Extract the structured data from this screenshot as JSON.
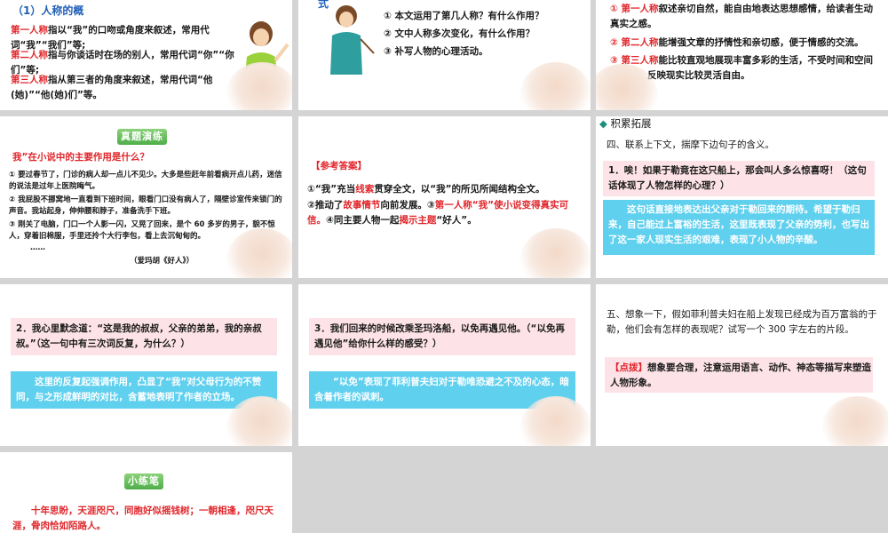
{
  "s1": {
    "heading": "（1）人称的概",
    "lines": [
      {
        "k": "第一人称",
        "v": "指以“我”的口吻或角度来叙述，常用代词“我”“我们”等;"
      },
      {
        "k": "第二人称",
        "v": "指与你谈话时在场的别人，常用代词“你”“你们”等;"
      },
      {
        "k": "第三人称",
        "v": "指从第三者的角度来叙述，常用代词“他(她)”“他(她)们”等。"
      }
    ]
  },
  "s2": {
    "corner": "式",
    "questions": [
      "① 本文运用了第几人称？有什么作用？",
      "② 文中人称多次变化，有什么作用？",
      "③ 补写人物的心理活动。"
    ]
  },
  "s3": {
    "lines": [
      {
        "k": "① 第一人称",
        "v": "叙述亲切自然，能自由地表达思想感情，给读者生动真实之感。"
      },
      {
        "k": "② 第二人称",
        "v": "能增强文章的抒情性和亲切感，便于情感的交流。"
      },
      {
        "k": "③ 第三人称",
        "v": "能比较直观地展现丰富多彩的生活，不受时间和空间的限制，反映现实比较灵活自由。"
      }
    ]
  },
  "s4": {
    "badge": "真题演练",
    "question": "我”在小说中的主要作用是什么？",
    "paras": [
      "① 要过春节了，门诊的病人却一点儿不见少。大多是些赶年前看病开点儿药，迷信的说法是过年上医院晦气。",
      "② 我屁股不挪窝地一直看到下班时间，眼看门口没有病人了，隔壁诊室传来锁门的声音。我站起身，伸伸腰和脖子，准备洗手下班。",
      "③ 刚关了电脑，门口一个人影一闪，又晃了回来，是个 60 多岁的男子，貌不惊人，穿着旧棉服，手里还拎个大行李包，看上去沉甸甸的。",
      "……"
    ],
    "source": "（爱玛胡《好人》）"
  },
  "s5": {
    "label": "【参考答案】",
    "a1_pre": "①“我”充当",
    "a1_hl": "线索",
    "a1_post": "贯穿全文，以“我”的所见所闻结构全文。",
    "a2_pre": "②推动了",
    "a2_hl": "故事情节",
    "a2_post": "向前发展。③",
    "a3_hl": "第一人称“我”使小说变得真实可信。",
    "a4_pre": "④同主要人物一起",
    "a4_hl": "揭示主题",
    "a4_post": "“好人”。"
  },
  "s6": {
    "tag": "积累拓展",
    "task": "四、联系上下文，揣摩下边句子的含义。",
    "q": "1．唉！如果于勒竟在这只船上，那会叫人多么惊喜呀！（这句话体现了人物怎样的心理？）",
    "a": "这句话直接地表达出父亲对于勒回来的期待。希望于勒归来，自己能过上富裕的生活，这里既表现了父亲的势利，也写出了这一家人现实生活的艰难，表现了小人物的辛酸。"
  },
  "s7": {
    "q": "2．我心里默念道：“这是我的叔叔，父亲的弟弟，我的亲叔叔。”（这一句中有三次词反复，为什么？）",
    "a": "这里的反复起强调作用，凸显了“我”对父母行为的不赞同，与之形成鲜明的对比，含蓄地表明了作者的立场。"
  },
  "s8": {
    "q": "3．我们回来的时候改乘圣玛洛船，以免再遇见他。（“以免再遇见他”给你什么样的感受？）",
    "a": "“以免”表现了菲利普夫妇对于勒唯恐避之不及的心态，暗含着作者的讽刺。"
  },
  "s9": {
    "task": "五、想象一下，假如菲利普夫妇在船上发现已经成为百万富翁的于勒，他们会有怎样的表现呢？试写一个 300 字左右的片段。",
    "tip_label": "【点拨】",
    "tip": "想象要合理，注意运用语言、动作、神态等描写来塑造人物形象。"
  },
  "s10": {
    "badge": "小练笔",
    "text": "十年思盼，天涯咫尺，同胞好似摇钱树；一朝相逢，咫尺天涯，骨肉恰如陌路人。"
  }
}
